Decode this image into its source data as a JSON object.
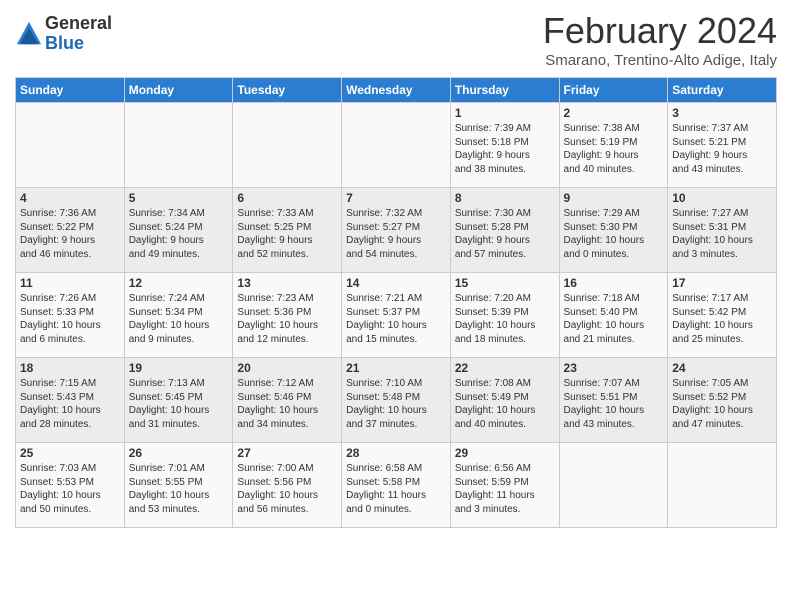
{
  "logo": {
    "general": "General",
    "blue": "Blue"
  },
  "header": {
    "month": "February 2024",
    "location": "Smarano, Trentino-Alto Adige, Italy"
  },
  "weekdays": [
    "Sunday",
    "Monday",
    "Tuesday",
    "Wednesday",
    "Thursday",
    "Friday",
    "Saturday"
  ],
  "weeks": [
    [
      {
        "day": "",
        "info": ""
      },
      {
        "day": "",
        "info": ""
      },
      {
        "day": "",
        "info": ""
      },
      {
        "day": "",
        "info": ""
      },
      {
        "day": "1",
        "info": "Sunrise: 7:39 AM\nSunset: 5:18 PM\nDaylight: 9 hours\nand 38 minutes."
      },
      {
        "day": "2",
        "info": "Sunrise: 7:38 AM\nSunset: 5:19 PM\nDaylight: 9 hours\nand 40 minutes."
      },
      {
        "day": "3",
        "info": "Sunrise: 7:37 AM\nSunset: 5:21 PM\nDaylight: 9 hours\nand 43 minutes."
      }
    ],
    [
      {
        "day": "4",
        "info": "Sunrise: 7:36 AM\nSunset: 5:22 PM\nDaylight: 9 hours\nand 46 minutes."
      },
      {
        "day": "5",
        "info": "Sunrise: 7:34 AM\nSunset: 5:24 PM\nDaylight: 9 hours\nand 49 minutes."
      },
      {
        "day": "6",
        "info": "Sunrise: 7:33 AM\nSunset: 5:25 PM\nDaylight: 9 hours\nand 52 minutes."
      },
      {
        "day": "7",
        "info": "Sunrise: 7:32 AM\nSunset: 5:27 PM\nDaylight: 9 hours\nand 54 minutes."
      },
      {
        "day": "8",
        "info": "Sunrise: 7:30 AM\nSunset: 5:28 PM\nDaylight: 9 hours\nand 57 minutes."
      },
      {
        "day": "9",
        "info": "Sunrise: 7:29 AM\nSunset: 5:30 PM\nDaylight: 10 hours\nand 0 minutes."
      },
      {
        "day": "10",
        "info": "Sunrise: 7:27 AM\nSunset: 5:31 PM\nDaylight: 10 hours\nand 3 minutes."
      }
    ],
    [
      {
        "day": "11",
        "info": "Sunrise: 7:26 AM\nSunset: 5:33 PM\nDaylight: 10 hours\nand 6 minutes."
      },
      {
        "day": "12",
        "info": "Sunrise: 7:24 AM\nSunset: 5:34 PM\nDaylight: 10 hours\nand 9 minutes."
      },
      {
        "day": "13",
        "info": "Sunrise: 7:23 AM\nSunset: 5:36 PM\nDaylight: 10 hours\nand 12 minutes."
      },
      {
        "day": "14",
        "info": "Sunrise: 7:21 AM\nSunset: 5:37 PM\nDaylight: 10 hours\nand 15 minutes."
      },
      {
        "day": "15",
        "info": "Sunrise: 7:20 AM\nSunset: 5:39 PM\nDaylight: 10 hours\nand 18 minutes."
      },
      {
        "day": "16",
        "info": "Sunrise: 7:18 AM\nSunset: 5:40 PM\nDaylight: 10 hours\nand 21 minutes."
      },
      {
        "day": "17",
        "info": "Sunrise: 7:17 AM\nSunset: 5:42 PM\nDaylight: 10 hours\nand 25 minutes."
      }
    ],
    [
      {
        "day": "18",
        "info": "Sunrise: 7:15 AM\nSunset: 5:43 PM\nDaylight: 10 hours\nand 28 minutes."
      },
      {
        "day": "19",
        "info": "Sunrise: 7:13 AM\nSunset: 5:45 PM\nDaylight: 10 hours\nand 31 minutes."
      },
      {
        "day": "20",
        "info": "Sunrise: 7:12 AM\nSunset: 5:46 PM\nDaylight: 10 hours\nand 34 minutes."
      },
      {
        "day": "21",
        "info": "Sunrise: 7:10 AM\nSunset: 5:48 PM\nDaylight: 10 hours\nand 37 minutes."
      },
      {
        "day": "22",
        "info": "Sunrise: 7:08 AM\nSunset: 5:49 PM\nDaylight: 10 hours\nand 40 minutes."
      },
      {
        "day": "23",
        "info": "Sunrise: 7:07 AM\nSunset: 5:51 PM\nDaylight: 10 hours\nand 43 minutes."
      },
      {
        "day": "24",
        "info": "Sunrise: 7:05 AM\nSunset: 5:52 PM\nDaylight: 10 hours\nand 47 minutes."
      }
    ],
    [
      {
        "day": "25",
        "info": "Sunrise: 7:03 AM\nSunset: 5:53 PM\nDaylight: 10 hours\nand 50 minutes."
      },
      {
        "day": "26",
        "info": "Sunrise: 7:01 AM\nSunset: 5:55 PM\nDaylight: 10 hours\nand 53 minutes."
      },
      {
        "day": "27",
        "info": "Sunrise: 7:00 AM\nSunset: 5:56 PM\nDaylight: 10 hours\nand 56 minutes."
      },
      {
        "day": "28",
        "info": "Sunrise: 6:58 AM\nSunset: 5:58 PM\nDaylight: 11 hours\nand 0 minutes."
      },
      {
        "day": "29",
        "info": "Sunrise: 6:56 AM\nSunset: 5:59 PM\nDaylight: 11 hours\nand 3 minutes."
      },
      {
        "day": "",
        "info": ""
      },
      {
        "day": "",
        "info": ""
      }
    ]
  ]
}
